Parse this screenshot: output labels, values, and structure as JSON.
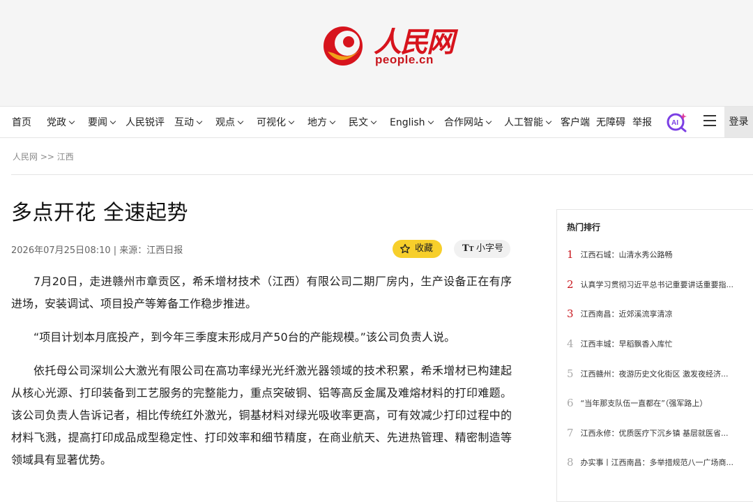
{
  "header": {
    "logo_cn": "人民网",
    "logo_en": "people.cn"
  },
  "nav": {
    "items": [
      {
        "label": "首页",
        "has_dropdown": false
      },
      {
        "label": "党政",
        "has_dropdown": true
      },
      {
        "label": "要闻",
        "has_dropdown": true
      },
      {
        "label": "人民锐评",
        "has_dropdown": false
      },
      {
        "label": "互动",
        "has_dropdown": true
      },
      {
        "label": "观点",
        "has_dropdown": true
      },
      {
        "label": "可视化",
        "has_dropdown": true
      },
      {
        "label": "地方",
        "has_dropdown": true
      },
      {
        "label": "民文",
        "has_dropdown": true
      },
      {
        "label": "English",
        "has_dropdown": true
      },
      {
        "label": "合作网站",
        "has_dropdown": true
      },
      {
        "label": "人工智能",
        "has_dropdown": true
      },
      {
        "label": "客户端",
        "has_dropdown": false
      },
      {
        "label": "无障碍",
        "has_dropdown": false
      },
      {
        "label": "举报",
        "has_dropdown": false
      }
    ],
    "ai_icon": "ai-search-icon",
    "menu_icon": "hamburger-menu-icon",
    "login_label": "登录"
  },
  "breadcrumb": "人民网 >> 江西",
  "article": {
    "title": "多点开花 全速起势",
    "meta": "2026年07月25日08:10 | 来源：江西日报",
    "favorite_label": "收藏",
    "font_size_label": "小字号",
    "paragraphs": [
      "7月20日，走进赣州市章贡区，希禾增材技术（江西）有限公司二期厂房内，生产设备正在有序进场，安装调试、项目投产等筹备工作稳步推进。",
      "“项目计划本月底投产，到今年三季度末形成月产50台的产能规模。”该公司负责人说。",
      "依托母公司深圳公大激光有限公司在高功率绿光光纤激光器领域的技术积累，希禾增材已构建起从核心光源、打印装备到工艺服务的完整能力，重点突破铜、铝等高反金属及难熔材料的打印难题。该公司负责人告诉记者，相比传统红外激光，铜基材料对绿光吸收率更高，可有效减少打印过程中的材料飞溅，提高打印成品成型稳定性、打印效率和细节精度，在商业航天、先进热管理、精密制造等领域具有显著优势。"
    ]
  },
  "sidebar": {
    "title": "热门排行",
    "items": [
      {
        "rank": "1",
        "text": "江西石城：山清水秀公路畅"
      },
      {
        "rank": "2",
        "text": "认真学习贯彻习近平总书记重要讲话重要指..."
      },
      {
        "rank": "3",
        "text": "江西南昌：近郊溪流享清凉"
      },
      {
        "rank": "4",
        "text": "江西丰城：早稻飘香入库忙"
      },
      {
        "rank": "5",
        "text": "江西赣州：夜游历史文化街区 激发夜经济..."
      },
      {
        "rank": "6",
        "text": "“当年那支队伍一直都在”（强军路上）"
      },
      {
        "rank": "7",
        "text": "江西永修：优质医疗下沉乡镇 基层就医省..."
      },
      {
        "rank": "8",
        "text": "办实事丨江西南昌：多举措规范八一广场商..."
      }
    ]
  }
}
